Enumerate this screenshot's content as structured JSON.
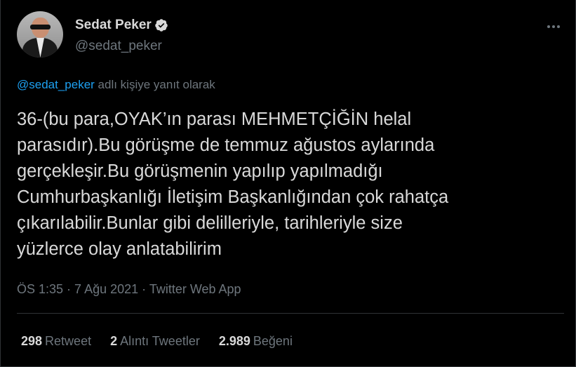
{
  "author": {
    "display_name": "Sedat Peker",
    "handle": "@sedat_peker",
    "verified_icon": "verified-badge-icon"
  },
  "reply_context": {
    "mention": "@sedat_peker",
    "text": " adlı kişiye yanıt olarak"
  },
  "tweet": {
    "text": "36-(bu para,OYAK’ın parası MEHMETÇİĞİN helal\nparasıdır).Bu görüşme de temmuz ağustos aylarında\ngerçekleşir.Bu görüşmenin yapılıp yapılmadığı\nCumhurbaşkanlığı İletişim Başkanlığından çok rahatça\nçıkarılabilir.Bunlar gibi delilleriyle, tarihleriyle size\nyüzlerce olay anlatabilirim",
    "time": "ÖS 1:35",
    "separator": " · ",
    "date": "7 Ağu 2021",
    "source": "Twitter Web App"
  },
  "stats": {
    "retweets_count": "298",
    "retweets_label": "Retweet",
    "quotes_count": "2",
    "quotes_label": "Alıntı Tweetler",
    "likes_count": "2.989",
    "likes_label": "Beğeni"
  },
  "colors": {
    "background": "#000000",
    "text": "#d9d9d9",
    "muted": "#6e767d",
    "accent": "#1da1f2",
    "border": "#2f3336"
  }
}
